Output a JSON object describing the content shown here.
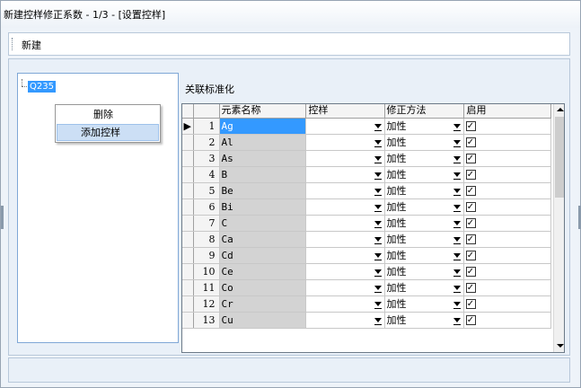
{
  "window": {
    "title": "新建控样修正系数 - 1/3 - [设置控样]"
  },
  "toolbar": {
    "new_label": "新建"
  },
  "tree": {
    "node_label": "Q235"
  },
  "context_menu": {
    "items": [
      {
        "label": "删除"
      },
      {
        "label": "添加控样"
      }
    ]
  },
  "section": {
    "label": "关联标准化"
  },
  "grid": {
    "columns": {
      "element": "元素名称",
      "control": "控样",
      "method": "修正方法",
      "enabled": "启用"
    },
    "current_row_marker": "▶",
    "rows": [
      {
        "num": "1",
        "element": "Ag",
        "control": "",
        "method": "加性",
        "enabled": true
      },
      {
        "num": "2",
        "element": "Al",
        "control": "",
        "method": "加性",
        "enabled": true
      },
      {
        "num": "3",
        "element": "As",
        "control": "",
        "method": "加性",
        "enabled": true
      },
      {
        "num": "4",
        "element": "B",
        "control": "",
        "method": "加性",
        "enabled": true
      },
      {
        "num": "5",
        "element": "Be",
        "control": "",
        "method": "加性",
        "enabled": true
      },
      {
        "num": "6",
        "element": "Bi",
        "control": "",
        "method": "加性",
        "enabled": true
      },
      {
        "num": "7",
        "element": "C",
        "control": "",
        "method": "加性",
        "enabled": true
      },
      {
        "num": "8",
        "element": "Ca",
        "control": "",
        "method": "加性",
        "enabled": true
      },
      {
        "num": "9",
        "element": "Cd",
        "control": "",
        "method": "加性",
        "enabled": true
      },
      {
        "num": "10",
        "element": "Ce",
        "control": "",
        "method": "加性",
        "enabled": true
      },
      {
        "num": "11",
        "element": "Co",
        "control": "",
        "method": "加性",
        "enabled": true
      },
      {
        "num": "12",
        "element": "Cr",
        "control": "",
        "method": "加性",
        "enabled": true
      },
      {
        "num": "13",
        "element": "Cu",
        "control": "",
        "method": "加性",
        "enabled": true
      }
    ]
  },
  "colors": {
    "selection": "#3399ff",
    "element_cell": "#d3d3d3",
    "header_bg": "#f4f4f4"
  }
}
